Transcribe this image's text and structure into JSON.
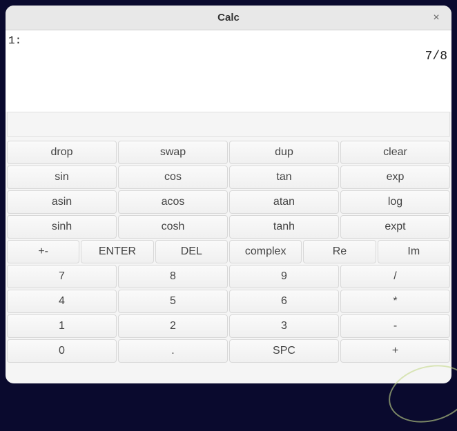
{
  "window": {
    "title": "Calc",
    "close_symbol": "×"
  },
  "display": {
    "stack_label": "1:",
    "stack_value": "7/8",
    "input": ""
  },
  "buttons": {
    "row1": [
      "drop",
      "swap",
      "dup",
      "clear"
    ],
    "row2": [
      "sin",
      "cos",
      "tan",
      "exp"
    ],
    "row3": [
      "asin",
      "acos",
      "atan",
      "log"
    ],
    "row4": [
      "sinh",
      "cosh",
      "tanh",
      "expt"
    ],
    "row5": [
      "+-",
      "ENTER",
      "DEL",
      "complex",
      "Re",
      "Im"
    ],
    "row6": [
      "7",
      "8",
      "9",
      "/"
    ],
    "row7": [
      "4",
      "5",
      "6",
      "*"
    ],
    "row8": [
      "1",
      "2",
      "3",
      "-"
    ],
    "row9": [
      "0",
      ".",
      "SPC",
      "+"
    ]
  }
}
